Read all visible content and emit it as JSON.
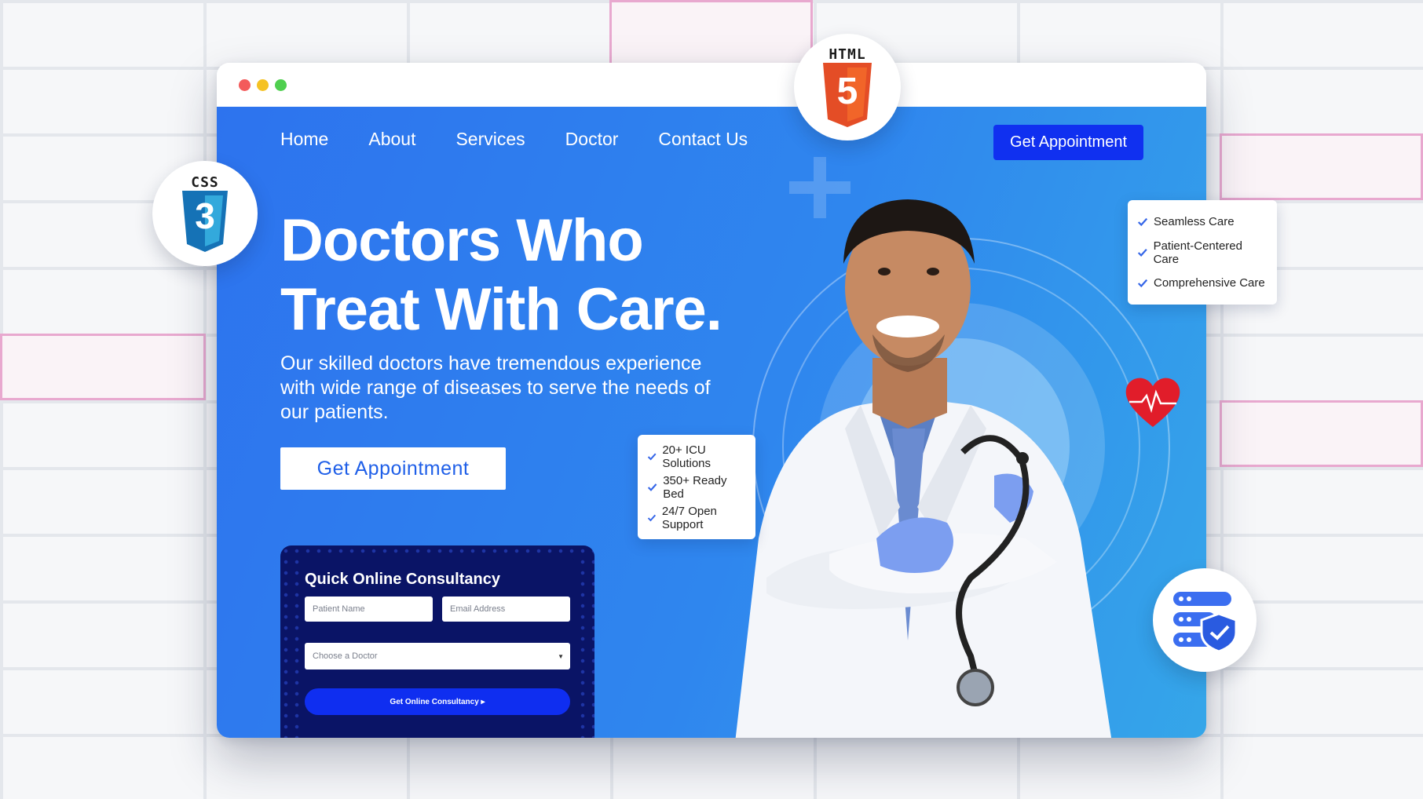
{
  "window": {
    "traffic_lights": [
      "#f35b5b",
      "#f5c223",
      "#4fcf4f"
    ]
  },
  "nav": {
    "items": [
      "Home",
      "About",
      "Services",
      "Doctor",
      "Contact Us"
    ],
    "cta_label": "Get Appointment"
  },
  "hero": {
    "headline_line1": "Doctors Who",
    "headline_line2": "Treat With Care.",
    "subtext": "Our skilled doctors have tremendous experience with wide range of diseases to serve the needs of our patients.",
    "cta_label": "Get Appointment"
  },
  "consultancy": {
    "title": "Quick Online Consultancy",
    "patient_name_placeholder": "Patient Name",
    "email_placeholder": "Email Address",
    "doctor_select_placeholder": "Choose a Doctor",
    "submit_label": "Get Online Consultancy ▸"
  },
  "features_left": [
    "20+ ICU Solutions",
    "350+ Ready Bed",
    "24/7 Open Support"
  ],
  "features_right": [
    "Seamless Care",
    "Patient-Centered Care",
    "Comprehensive Care"
  ],
  "badges": {
    "html": "HTML",
    "css": "CSS",
    "html_number": "5",
    "css_number": "3"
  },
  "colors": {
    "primary": "#2d73ee",
    "nav_cta": "#1030f0",
    "card_dark": "#0a1466",
    "check": "#3566e8"
  }
}
